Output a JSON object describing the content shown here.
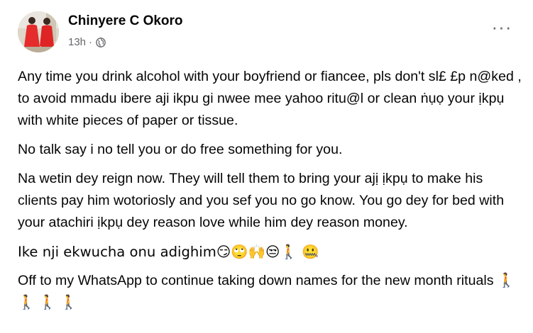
{
  "post": {
    "author": "Chinyere C Okoro",
    "time": "13h",
    "separator": "·",
    "privacy_icon": "globe-icon",
    "more_icon": "more-dots-icon",
    "more_label": "···",
    "paragraphs": [
      "Any time you drink alcohol with your boyfriend or fiancee, pls don't sl£ £p n@ked , to avoid mmadu ibere aji ikpu gi nwee mee yahoo ritu@l or clean ṅụọ your ịkpụ with white pieces of paper or tissue.",
      "No talk say i no tell you or do free something for you.",
      "Na wetin dey reign now. They will tell them to bring your ajị ịkpụ to make his clients pay him wotoriosly and you sef you no go know. You go dey for bed with your atachiri ịkpụ dey reason love while him dey reason money.",
      "Ike nji ekwucha onu adighim😏🙄🙌😒🚶 🤐",
      "Off to my WhatsApp to continue taking down names for the new month rituals 🚶 🚶 🚶 🚶"
    ]
  },
  "colors": {
    "text": "#050505",
    "secondary": "#65676b",
    "background": "#ffffff"
  }
}
